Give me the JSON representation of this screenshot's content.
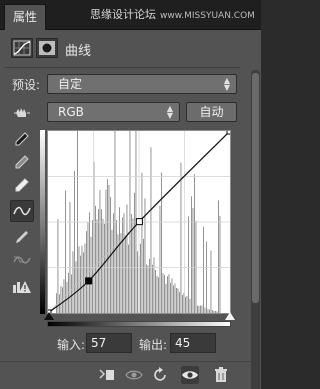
{
  "window": {
    "tab_label": "属性",
    "watermark_text": "思缘设计论坛",
    "watermark_url": "www.MISSYUAN.COM"
  },
  "panel": {
    "title": "曲线",
    "adjustment_icon": "curves-adjustment-icon",
    "mask_icon": "layer-mask-icon"
  },
  "preset": {
    "label": "预设:",
    "value": "自定"
  },
  "channel": {
    "value": "RGB",
    "auto_label": "自动"
  },
  "tools": [
    {
      "name": "on-image-adjust-icon",
      "active": false
    },
    {
      "name": "black-point-eyedropper-icon",
      "active": false
    },
    {
      "name": "gray-point-eyedropper-icon",
      "active": false
    },
    {
      "name": "white-point-eyedropper-icon",
      "active": false
    },
    {
      "name": "curve-points-icon",
      "active": true
    },
    {
      "name": "pencil-icon",
      "active": false
    },
    {
      "name": "smooth-icon",
      "active": false
    },
    {
      "name": "clipping-warning-icon",
      "active": false
    }
  ],
  "curve": {
    "points": [
      [
        0,
        0
      ],
      [
        57,
        45
      ],
      [
        128,
        128
      ],
      [
        255,
        255
      ]
    ]
  },
  "io": {
    "input_label": "输入:",
    "input_value": "57",
    "output_label": "输出:",
    "output_value": "45"
  },
  "footer_icons": [
    "clip-to-layer-icon",
    "view-previous-icon",
    "reset-icon",
    "visibility-eye-icon",
    "delete-trash-icon"
  ],
  "colors": {
    "panel_bg": "#535353",
    "titlebar_bg": "#1f1f1f",
    "graph_bg": "#ffffff",
    "histogram": "#888888"
  }
}
